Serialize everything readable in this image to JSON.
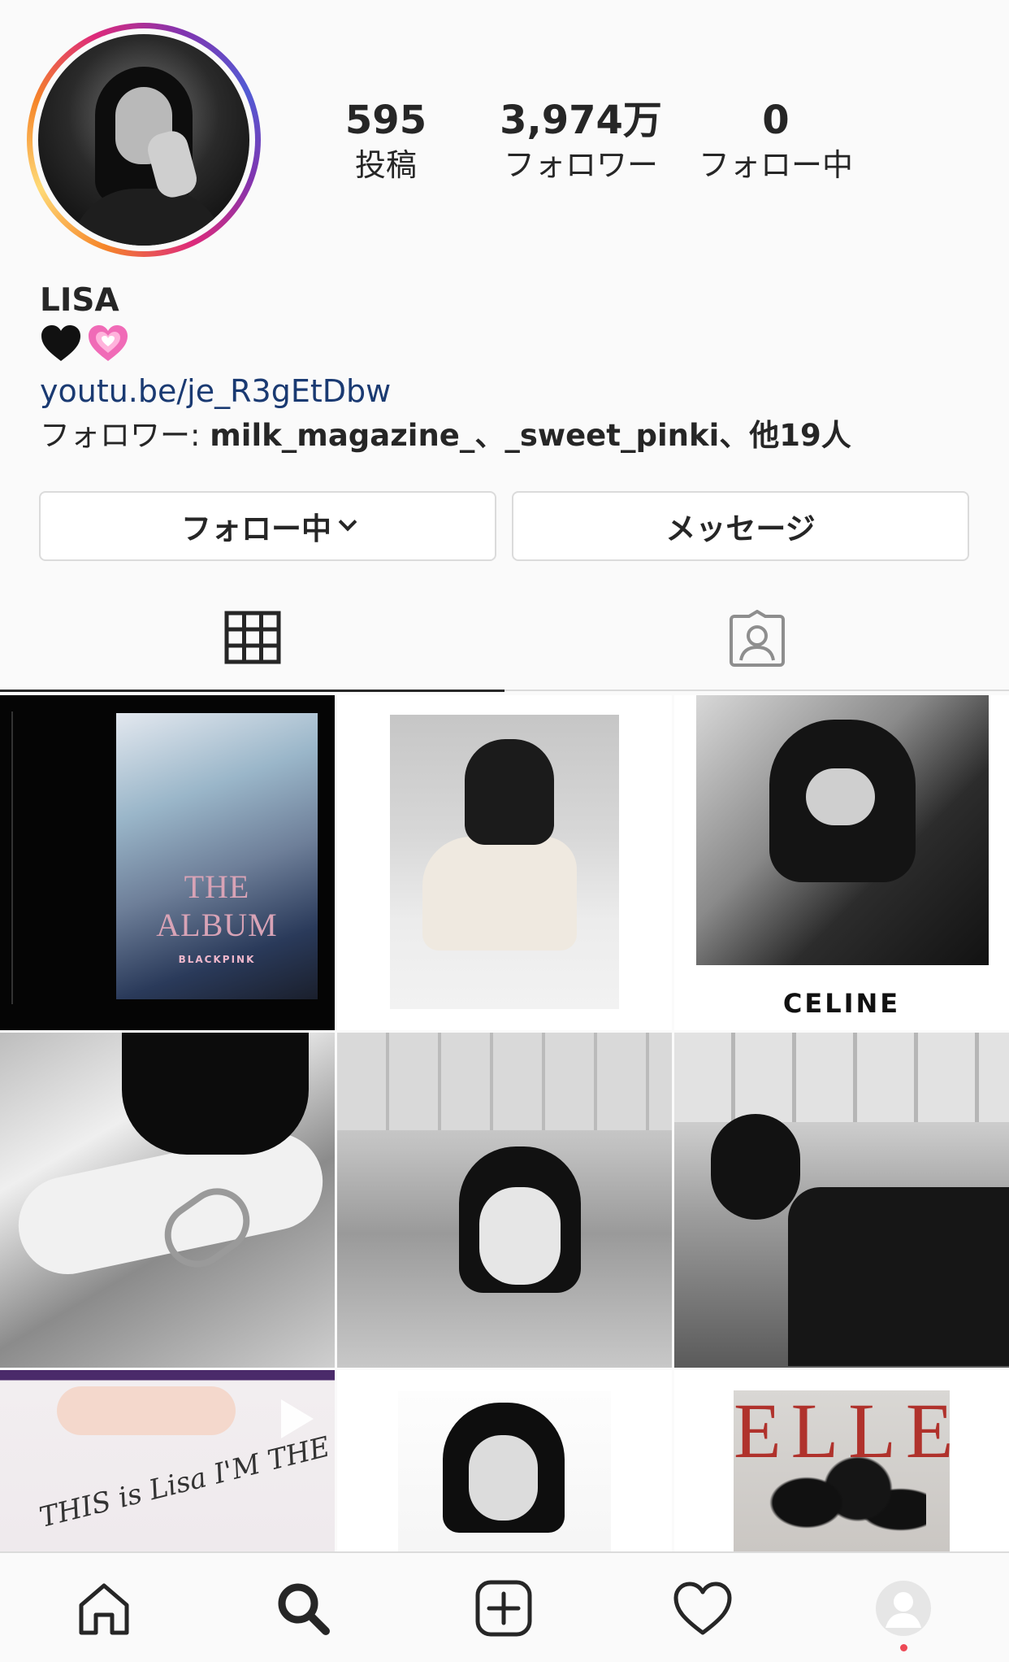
{
  "profile": {
    "stats": {
      "posts": {
        "value": "595",
        "label": "投稿"
      },
      "followers": {
        "value": "3,974万",
        "label": "フォロワー"
      },
      "following": {
        "value": "0",
        "label": "フォロー中"
      }
    },
    "name": "LISA",
    "bio_emojis": [
      "black-heart",
      "pink-heart"
    ],
    "link": "youtu.be/je_R3gEtDbw",
    "followed_by": {
      "prefix": "フォロワー: ",
      "names": "milk_magazine_、_sweet_pinki、他19人"
    }
  },
  "actions": {
    "follow_label": "フォロー中",
    "message_label": "メッセージ"
  },
  "tabs": [
    {
      "name": "grid",
      "icon": "grid-icon",
      "active": true
    },
    {
      "name": "tagged",
      "icon": "tagged-icon",
      "active": false
    }
  ],
  "posts": [
    {
      "kind": "album-cover",
      "text": "THE ALBUM",
      "subtext": "BLACKPINK"
    },
    {
      "kind": "photo"
    },
    {
      "kind": "photo-ad",
      "text": "CELINE"
    },
    {
      "kind": "photo"
    },
    {
      "kind": "photo"
    },
    {
      "kind": "photo"
    },
    {
      "kind": "video",
      "text": "THIS is Lisa I'M THE NEW BVLGARI"
    },
    {
      "kind": "photo"
    },
    {
      "kind": "magazine-cover",
      "text": "ELLE"
    }
  ],
  "bottom_nav": [
    {
      "name": "home",
      "icon": "home-icon"
    },
    {
      "name": "search",
      "icon": "search-icon",
      "active": true
    },
    {
      "name": "add",
      "icon": "add-post-icon"
    },
    {
      "name": "activity",
      "icon": "heart-icon"
    },
    {
      "name": "profile",
      "icon": "profile-icon"
    }
  ],
  "colors": {
    "link": "#1a3a72",
    "text": "#262626",
    "border": "#dbdbdb",
    "notification_dot": "#ed4956",
    "pink_heart": "#f06bb7"
  }
}
